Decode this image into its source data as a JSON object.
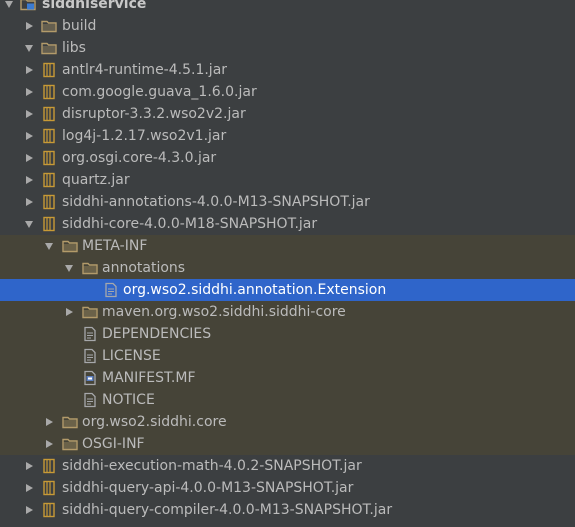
{
  "colors": {
    "background": "#3c3f41",
    "text": "#bbbbbb",
    "expanded_band": "#464438",
    "selection": "#2f65ca",
    "folder": "#b39b6a",
    "jar": "#c79a36",
    "file": "#a6a8ab"
  },
  "tree": [
    {
      "label": "siddhiservice",
      "depth": 0,
      "icon": "module-folder-icon",
      "arrow": "down",
      "state": "root"
    },
    {
      "label": "build",
      "depth": 1,
      "icon": "folder-icon",
      "arrow": "right",
      "state": ""
    },
    {
      "label": "libs",
      "depth": 1,
      "icon": "folder-icon",
      "arrow": "down",
      "state": ""
    },
    {
      "label": "antlr4-runtime-4.5.1.jar",
      "depth": 2,
      "icon": "jar-icon",
      "arrow": "right",
      "state": ""
    },
    {
      "label": "com.google.guava_1.6.0.jar",
      "depth": 2,
      "icon": "jar-icon",
      "arrow": "right",
      "state": ""
    },
    {
      "label": "disruptor-3.3.2.wso2v2.jar",
      "depth": 2,
      "icon": "jar-icon",
      "arrow": "right",
      "state": ""
    },
    {
      "label": "log4j-1.2.17.wso2v1.jar",
      "depth": 2,
      "icon": "jar-icon",
      "arrow": "right",
      "state": ""
    },
    {
      "label": "org.osgi.core-4.3.0.jar",
      "depth": 2,
      "icon": "jar-icon",
      "arrow": "right",
      "state": ""
    },
    {
      "label": "quartz.jar",
      "depth": 2,
      "icon": "jar-icon",
      "arrow": "right",
      "state": ""
    },
    {
      "label": "siddhi-annotations-4.0.0-M13-SNAPSHOT.jar",
      "depth": 2,
      "icon": "jar-icon",
      "arrow": "right",
      "state": ""
    },
    {
      "label": "siddhi-core-4.0.0-M18-SNAPSHOT.jar",
      "depth": 2,
      "icon": "jar-icon",
      "arrow": "down",
      "state": ""
    },
    {
      "label": "META-INF",
      "depth": 3,
      "icon": "folder-icon",
      "arrow": "down",
      "state": "band"
    },
    {
      "label": "annotations",
      "depth": 4,
      "icon": "folder-icon",
      "arrow": "down",
      "state": "band"
    },
    {
      "label": "org.wso2.siddhi.annotation.Extension",
      "depth": 5,
      "icon": "file-icon",
      "arrow": "none",
      "state": "selected"
    },
    {
      "label": "maven.org.wso2.siddhi.siddhi-core",
      "depth": 4,
      "icon": "folder-icon",
      "arrow": "right",
      "state": "band"
    },
    {
      "label": "DEPENDENCIES",
      "depth": 4,
      "icon": "file-icon",
      "arrow": "none",
      "state": "band"
    },
    {
      "label": "LICENSE",
      "depth": 4,
      "icon": "file-icon",
      "arrow": "none",
      "state": "band"
    },
    {
      "label": "MANIFEST.MF",
      "depth": 4,
      "icon": "manifest-icon",
      "arrow": "none",
      "state": "band"
    },
    {
      "label": "NOTICE",
      "depth": 4,
      "icon": "file-icon",
      "arrow": "none",
      "state": "band"
    },
    {
      "label": "org.wso2.siddhi.core",
      "depth": 3,
      "icon": "folder-icon",
      "arrow": "right",
      "state": "band"
    },
    {
      "label": "OSGI-INF",
      "depth": 3,
      "icon": "folder-icon",
      "arrow": "right",
      "state": "band"
    },
    {
      "label": "siddhi-execution-math-4.0.2-SNAPSHOT.jar",
      "depth": 2,
      "icon": "jar-icon",
      "arrow": "right",
      "state": ""
    },
    {
      "label": "siddhi-query-api-4.0.0-M13-SNAPSHOT.jar",
      "depth": 2,
      "icon": "jar-icon",
      "arrow": "right",
      "state": ""
    },
    {
      "label": "siddhi-query-compiler-4.0.0-M13-SNAPSHOT.jar",
      "depth": 2,
      "icon": "jar-icon",
      "arrow": "right",
      "state": ""
    }
  ]
}
